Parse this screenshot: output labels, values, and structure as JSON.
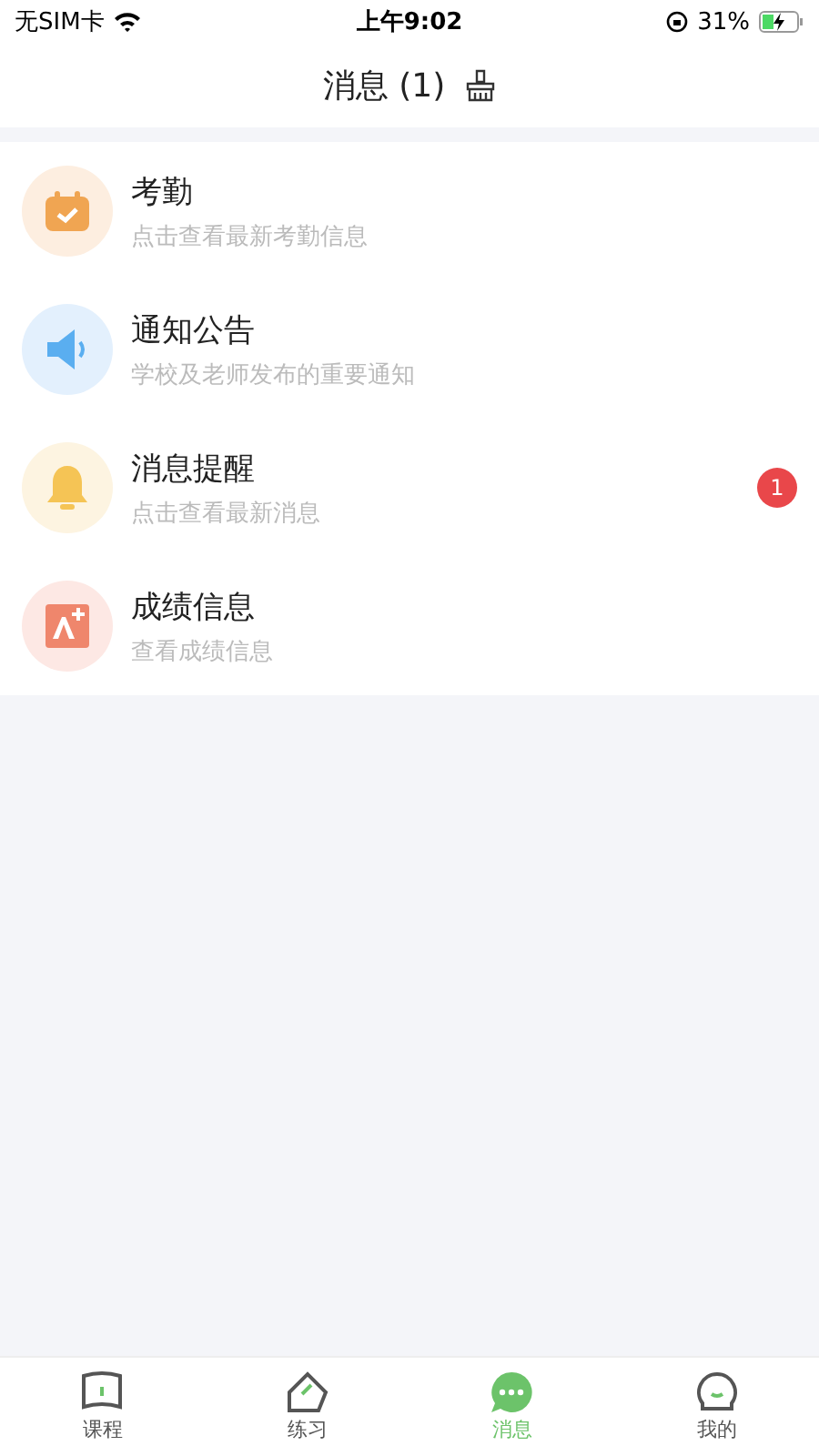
{
  "status_bar": {
    "carrier": "无SIM卡",
    "time": "上午9:02",
    "battery": "31%"
  },
  "header": {
    "title": "消息 (1)"
  },
  "items": [
    {
      "kind": "calendar",
      "title": "考勤",
      "subtitle": "点击查看最新考勤信息"
    },
    {
      "kind": "speaker",
      "title": "通知公告",
      "subtitle": "学校及老师发布的重要通知"
    },
    {
      "kind": "bell",
      "title": "消息提醒",
      "subtitle": "点击查看最新消息",
      "badge": "1"
    },
    {
      "kind": "grade",
      "title": "成绩信息",
      "subtitle": "查看成绩信息"
    }
  ],
  "tabs": [
    {
      "kind": "course",
      "label": "课程",
      "selected": false
    },
    {
      "kind": "practice",
      "label": "练习",
      "selected": false
    },
    {
      "kind": "message",
      "label": "消息",
      "selected": true
    },
    {
      "kind": "profile",
      "label": "我的",
      "selected": false
    }
  ]
}
